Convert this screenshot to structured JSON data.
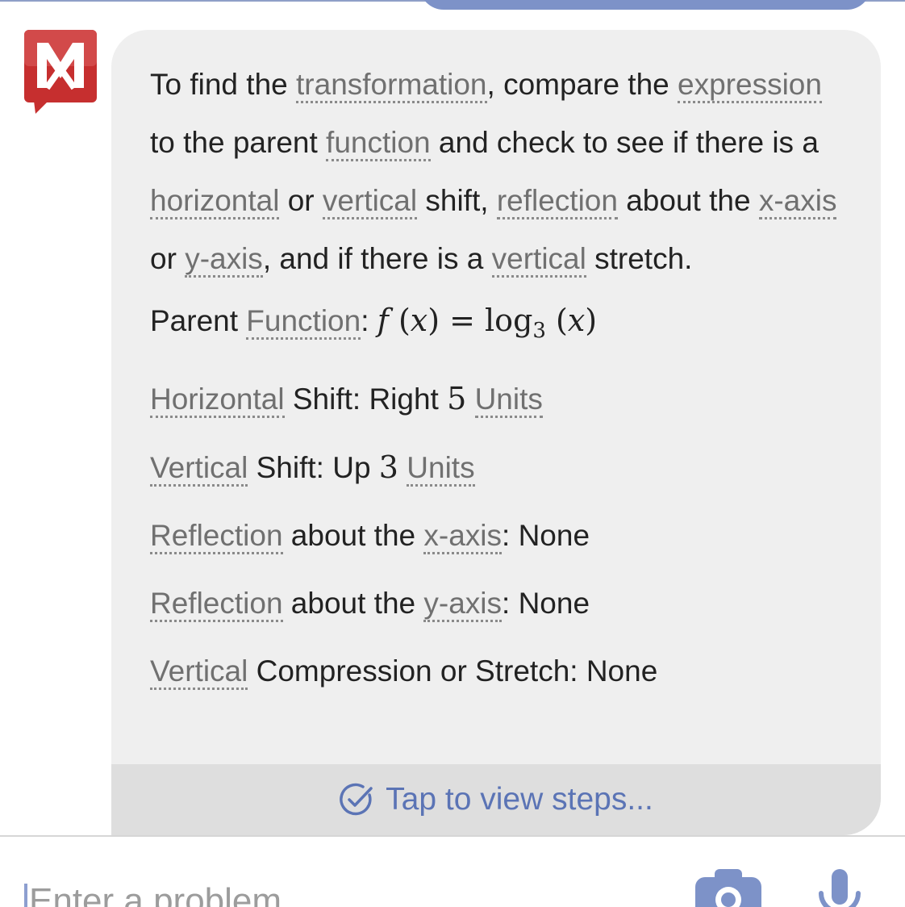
{
  "brand": {
    "logo_letter": "M",
    "logo_color": "#c62f2f"
  },
  "accent_color": "#5b74b5",
  "intro": {
    "p1": "To find the ",
    "t1": "transformation",
    "p2": ", compare the ",
    "t2": "expression",
    "p3": " to the parent ",
    "t3": "function",
    "p4": " and check to see if there is a ",
    "t4": "horizontal",
    "p5": " or ",
    "t5": "vertical",
    "p6": " shift, ",
    "t6": "reflection",
    "p7": " about the ",
    "t7": "x-axis",
    "p8": " or ",
    "t8": "y-axis",
    "p9": ", and if there is a ",
    "t9": "vertical",
    "p10": " stretch."
  },
  "results": {
    "parent": {
      "label_pre": "Parent ",
      "term": "Function",
      "colon": ": ",
      "math_f": "f",
      "math_x1": "x",
      "math_log": "log",
      "math_base": "3",
      "math_x2": "x"
    },
    "horizontal": {
      "term": "Horizontal",
      "text": " Shift: Right ",
      "num": "5",
      "unit": "Units"
    },
    "vertical": {
      "term": "Vertical",
      "text": " Shift: Up ",
      "num": "3",
      "unit": "Units"
    },
    "refl_x": {
      "term": "Reflection",
      "text": " about the ",
      "axis": "x-axis",
      "value": ": None"
    },
    "refl_y": {
      "term": "Reflection",
      "text": " about the ",
      "axis": "y-axis",
      "value": ": None"
    },
    "stretch": {
      "term": "Vertical",
      "text": " Compression or Stretch: None"
    }
  },
  "steps_label": "Tap to view steps...",
  "input": {
    "placeholder": "Enter a problem"
  },
  "icons": {
    "check": "check-circle-icon",
    "camera": "camera-icon",
    "mic": "microphone-icon"
  }
}
